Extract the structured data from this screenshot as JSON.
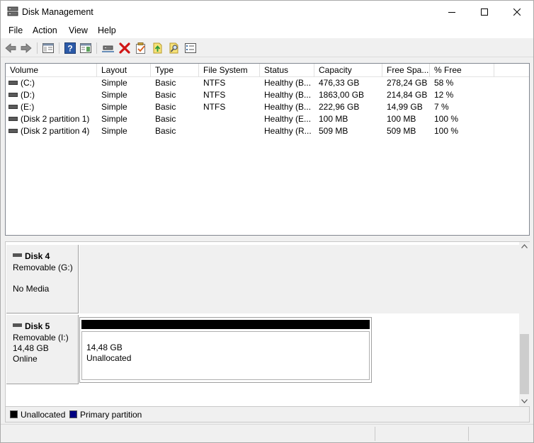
{
  "window": {
    "title": "Disk Management"
  },
  "menu": [
    "File",
    "Action",
    "View",
    "Help"
  ],
  "toolbar": {
    "buttons": [
      "back-icon",
      "forward-icon",
      "console-tree-icon",
      "help-icon",
      "show-hide-icon",
      "connect-icon",
      "delete-icon",
      "properties-icon",
      "export-icon",
      "find-icon",
      "settings-icon"
    ]
  },
  "volumes": {
    "columns": [
      "Volume",
      "Layout",
      "Type",
      "File System",
      "Status",
      "Capacity",
      "Free Spa...",
      "% Free"
    ],
    "rows": [
      [
        "(C:)",
        "Simple",
        "Basic",
        "NTFS",
        "Healthy (B...",
        "476,33 GB",
        "278,24 GB",
        "58 %"
      ],
      [
        "(D:)",
        "Simple",
        "Basic",
        "NTFS",
        "Healthy (B...",
        "1863,00 GB",
        "214,84 GB",
        "12 %"
      ],
      [
        "(E:)",
        "Simple",
        "Basic",
        "NTFS",
        "Healthy (B...",
        "222,96 GB",
        "14,99 GB",
        "7 %"
      ],
      [
        "(Disk 2 partition 1)",
        "Simple",
        "Basic",
        "",
        "Healthy (E...",
        "100 MB",
        "100 MB",
        "100 %"
      ],
      [
        "(Disk 2 partition 4)",
        "Simple",
        "Basic",
        "",
        "Healthy (R...",
        "509 MB",
        "509 MB",
        "100 %"
      ]
    ]
  },
  "disks": [
    {
      "name": "Disk 4",
      "type": "Removable (G:)",
      "size": "",
      "state": "No Media"
    },
    {
      "name": "Disk 5",
      "type": "Removable (I:)",
      "size": "14,48 GB",
      "state": "Online",
      "partition": {
        "size": "14,48 GB",
        "label": "Unallocated"
      }
    }
  ],
  "legend": [
    {
      "label": "Unallocated",
      "color": "#000000"
    },
    {
      "label": "Primary partition",
      "color": "#000080"
    }
  ]
}
